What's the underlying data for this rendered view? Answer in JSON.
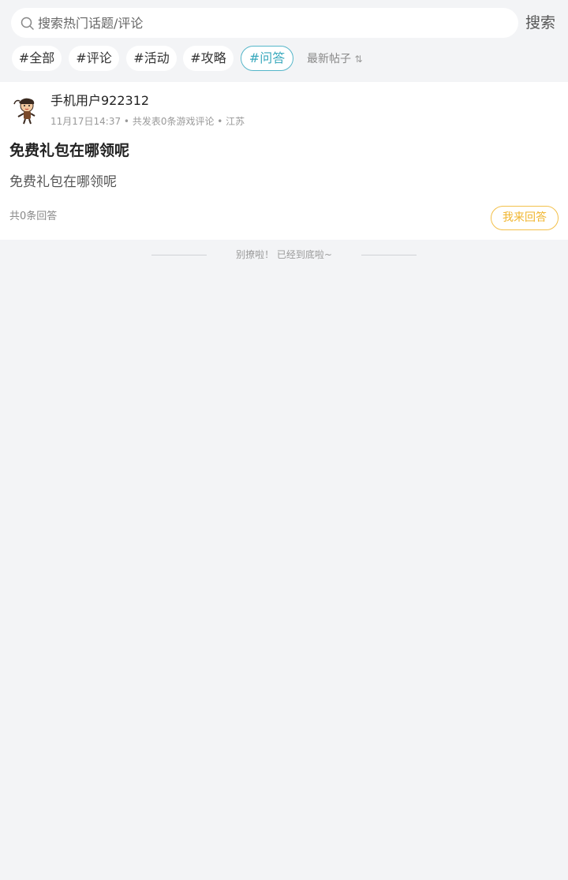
{
  "search": {
    "placeholder": "搜索热门话题/评论",
    "button_label": "搜索"
  },
  "tags": [
    {
      "label": "#全部",
      "active": false
    },
    {
      "label": "#评论",
      "active": false
    },
    {
      "label": "#活动",
      "active": false
    },
    {
      "label": "#攻略",
      "active": false
    },
    {
      "label": "#问答",
      "active": true
    }
  ],
  "sort": {
    "label": "最新帖子",
    "icon": "sort-arrows-icon",
    "icon_glyph": "⇅"
  },
  "post": {
    "username": "手机用户922312",
    "meta": "11月17日14:37 • 共发表0条游戏评论 • 江苏",
    "title": "免费礼包在哪领呢",
    "body": "免费礼包在哪领呢",
    "answer_count": "共0条回答",
    "answer_button": "我来回答"
  },
  "footer": {
    "end_text": "别撩啦！ 已经到底啦~"
  },
  "colors": {
    "background": "#f3f4f6",
    "card": "#ffffff",
    "active_tag": "#3aa9bd",
    "answer_accent": "#f0b52e"
  }
}
